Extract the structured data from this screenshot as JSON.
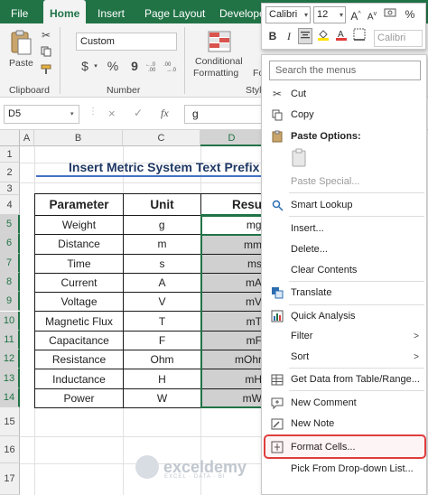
{
  "ribbon": {
    "tabs": [
      "File",
      "Home",
      "Insert",
      "Page Layout",
      "Develope"
    ],
    "active_tab": "Home",
    "clipboard": {
      "paste_label": "Paste",
      "group_label": "Clipboard"
    },
    "number": {
      "format_value": "Custom",
      "currency_symbol": "$",
      "percent_symbol": "%",
      "comma_symbol": "9",
      "group_label": "Number"
    },
    "styles": {
      "conditional_label1": "Conditional",
      "conditional_label2": "Formatting",
      "truncated_label": "Fo",
      "group_label": "Styl"
    }
  },
  "formula_bar": {
    "name_box": "D5",
    "cancel_symbol": "×",
    "enter_symbol": "✓",
    "fx_symbol": "fx",
    "value": "g"
  },
  "grid": {
    "columns": [
      "A",
      "B",
      "C",
      "D"
    ],
    "selected_column": "D",
    "rows": [
      "1",
      "2",
      "3",
      "4",
      "5",
      "6",
      "7",
      "8",
      "9",
      "10",
      "11",
      "12",
      "13",
      "14",
      "15",
      "16",
      "17"
    ],
    "title": "Insert Metric System Text Prefix",
    "headers": [
      "Parameter",
      "Unit",
      "Resu"
    ],
    "data": [
      {
        "param": "Weight",
        "unit": "g",
        "result": "mg"
      },
      {
        "param": "Distance",
        "unit": "m",
        "result": "mm"
      },
      {
        "param": "Time",
        "unit": "s",
        "result": "ms"
      },
      {
        "param": "Current",
        "unit": "A",
        "result": "mA"
      },
      {
        "param": "Voltage",
        "unit": "V",
        "result": "mV"
      },
      {
        "param": "Magnetic Flux",
        "unit": "T",
        "result": "mT"
      },
      {
        "param": "Capacitance",
        "unit": "F",
        "result": "mF"
      },
      {
        "param": "Resistance",
        "unit": "Ohm",
        "result": "mOhr"
      },
      {
        "param": "Inductance",
        "unit": "H",
        "result": "mH"
      },
      {
        "param": "Power",
        "unit": "W",
        "result": "mW"
      }
    ]
  },
  "mini_toolbar": {
    "font_name": "Calibri",
    "font_size": "12",
    "grow_symbol": "A",
    "shrink_symbol": "A",
    "bold": "B",
    "italic": "I",
    "ghost_font": "Calibri"
  },
  "context_menu": {
    "search_placeholder": "Search the menus",
    "cut": "Cut",
    "copy": "Copy",
    "paste_options": "Paste Options:",
    "paste_special": "Paste Special...",
    "smart_lookup": "Smart Lookup",
    "insert": "Insert...",
    "delete": "Delete...",
    "clear_contents": "Clear Contents",
    "translate": "Translate",
    "quick_analysis": "Quick Analysis",
    "filter": "Filter",
    "sort": "Sort",
    "get_data": "Get Data from Table/Range...",
    "new_comment": "New Comment",
    "new_note": "New Note",
    "format_cells": "Format Cells...",
    "pick_list": "Pick From Drop-down List..."
  },
  "watermark": {
    "name": "exceldemy",
    "tagline": "EXCEL · DATA · BI"
  },
  "colors": {
    "excel_green": "#217346",
    "highlight_red": "#e03c3c",
    "title_blue": "#1f3864"
  }
}
